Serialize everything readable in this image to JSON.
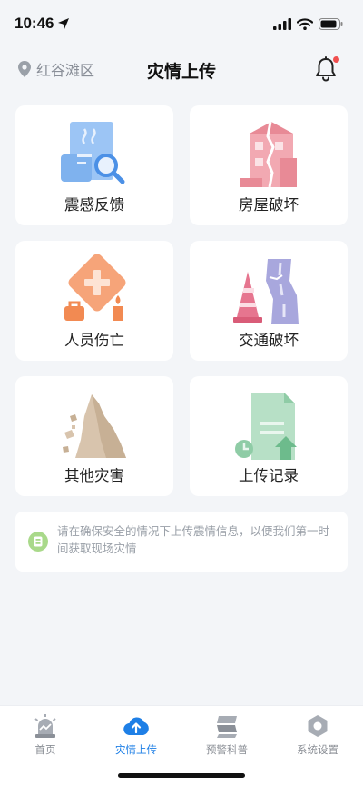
{
  "status_bar": {
    "time": "10:46"
  },
  "header": {
    "location": "红谷滩区",
    "title": "灾情上传"
  },
  "cards": [
    {
      "label": "震感反馈",
      "icon": "seismic-report-icon"
    },
    {
      "label": "房屋破坏",
      "icon": "damaged-house-icon"
    },
    {
      "label": "人员伤亡",
      "icon": "casualty-icon"
    },
    {
      "label": "交通破坏",
      "icon": "broken-road-icon"
    },
    {
      "label": "其他灾害",
      "icon": "landslide-icon"
    },
    {
      "label": "上传记录",
      "icon": "upload-record-icon"
    }
  ],
  "tip": {
    "text": "请在确保安全的情况下上传震情信息，以便我们第一时间获取现场灾情"
  },
  "nav": [
    {
      "label": "首页",
      "icon": "home-alarm-icon"
    },
    {
      "label": "灾情上传",
      "icon": "cloud-upload-icon"
    },
    {
      "label": "预警科普",
      "icon": "warning-book-icon"
    },
    {
      "label": "系统设置",
      "icon": "settings-hex-icon"
    }
  ],
  "colors": {
    "accent": "#1e7fe6",
    "badge": "#f04f4f",
    "page_bg": "#f3f5f8"
  }
}
